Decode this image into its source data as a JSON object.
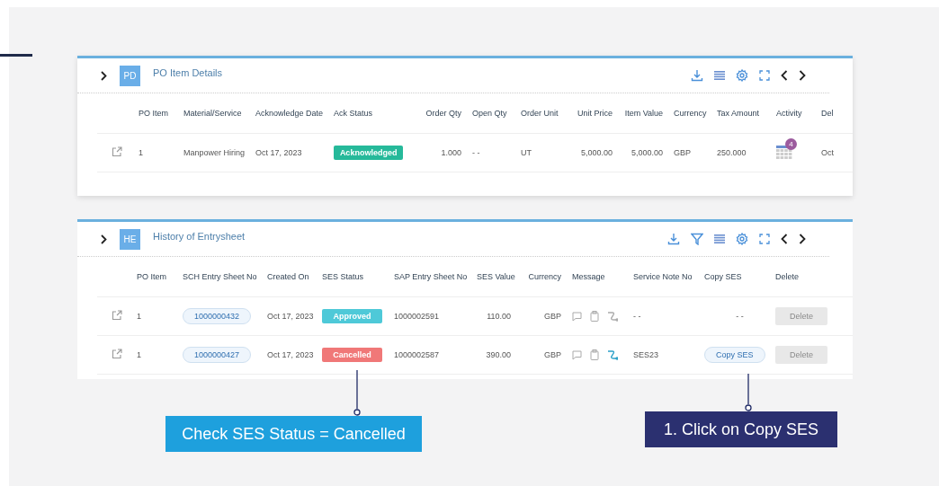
{
  "cards": [
    {
      "badge": "PD",
      "title": "PO Item Details",
      "tools": [
        {
          "kind": "download"
        },
        {
          "kind": "list"
        },
        {
          "kind": "settings"
        },
        {
          "kind": "fullscreen"
        },
        {
          "kind": "prev"
        },
        {
          "kind": "next"
        }
      ],
      "columns": [
        "",
        "PO Item",
        "Material/Service",
        "Acknowledge Date",
        "Ack Status",
        "Order Qty",
        "Open Qty",
        "Order Unit",
        "Unit Price",
        "Item Value",
        "Currency",
        "Tax Amount",
        "Activity",
        "Del"
      ],
      "rows": [
        {
          "cells": [
            {
              "kind": "open"
            },
            {
              "kind": "text",
              "text": "1"
            },
            {
              "kind": "text",
              "text": "Manpower Hiring"
            },
            {
              "kind": "text",
              "text": "Oct 17, 2023"
            },
            {
              "kind": "status",
              "text": "Acknowledged",
              "color": "#26b99a"
            },
            {
              "kind": "number",
              "text": "1.000"
            },
            {
              "kind": "text",
              "text": "- -"
            },
            {
              "kind": "text",
              "text": "UT"
            },
            {
              "kind": "number",
              "text": "5,000.00"
            },
            {
              "kind": "number",
              "text": "5,000.00"
            },
            {
              "kind": "text",
              "text": "GBP"
            },
            {
              "kind": "text",
              "text": "250.000"
            },
            {
              "kind": "activity",
              "count": "4"
            },
            {
              "kind": "text",
              "text": "Oct"
            }
          ]
        }
      ]
    },
    {
      "badge": "HE",
      "title": "History of Entrysheet",
      "tools": [
        {
          "kind": "download"
        },
        {
          "kind": "filter"
        },
        {
          "kind": "list"
        },
        {
          "kind": "settings"
        },
        {
          "kind": "fullscreen"
        },
        {
          "kind": "prev"
        },
        {
          "kind": "next"
        }
      ],
      "columns": [
        "",
        "PO Item",
        "SCH Entry Sheet No",
        "Created On",
        "SES Status",
        "SAP Entry Sheet No",
        "SES Value",
        "Currency",
        "Message",
        "Service Note No",
        "Copy SES",
        "Delete"
      ],
      "rows": [
        {
          "cells": [
            {
              "kind": "open"
            },
            {
              "kind": "text",
              "text": "1"
            },
            {
              "kind": "pill",
              "text": "1000000432"
            },
            {
              "kind": "text",
              "text": "Oct 17, 2023"
            },
            {
              "kind": "status",
              "text": "Approved",
              "color": "#4ec9d8"
            },
            {
              "kind": "text",
              "text": "1000002591"
            },
            {
              "kind": "number",
              "text": "110.00"
            },
            {
              "kind": "number",
              "text": "GBP"
            },
            {
              "kind": "messages",
              "active": false
            },
            {
              "kind": "text",
              "text": "- -"
            },
            {
              "kind": "center",
              "text": "- -"
            },
            {
              "kind": "button",
              "text": "Delete",
              "disabled": true
            }
          ]
        },
        {
          "cells": [
            {
              "kind": "open"
            },
            {
              "kind": "text",
              "text": "1"
            },
            {
              "kind": "pill",
              "text": "1000000427"
            },
            {
              "kind": "text",
              "text": "Oct 17, 2023"
            },
            {
              "kind": "status",
              "text": "Cancelled",
              "color": "#f07878"
            },
            {
              "kind": "text",
              "text": "1000002587"
            },
            {
              "kind": "number",
              "text": "390.00"
            },
            {
              "kind": "number",
              "text": "GBP"
            },
            {
              "kind": "messages",
              "active": true
            },
            {
              "kind": "text",
              "text": "SES23"
            },
            {
              "kind": "pill",
              "text": "Copy SES"
            },
            {
              "kind": "button",
              "text": "Delete",
              "disabled": true
            }
          ]
        }
      ]
    }
  ],
  "callouts": [
    {
      "text": "Check SES Status = Cancelled",
      "kind": "light"
    },
    {
      "text": "1. Click on Copy SES",
      "kind": "dark"
    }
  ]
}
